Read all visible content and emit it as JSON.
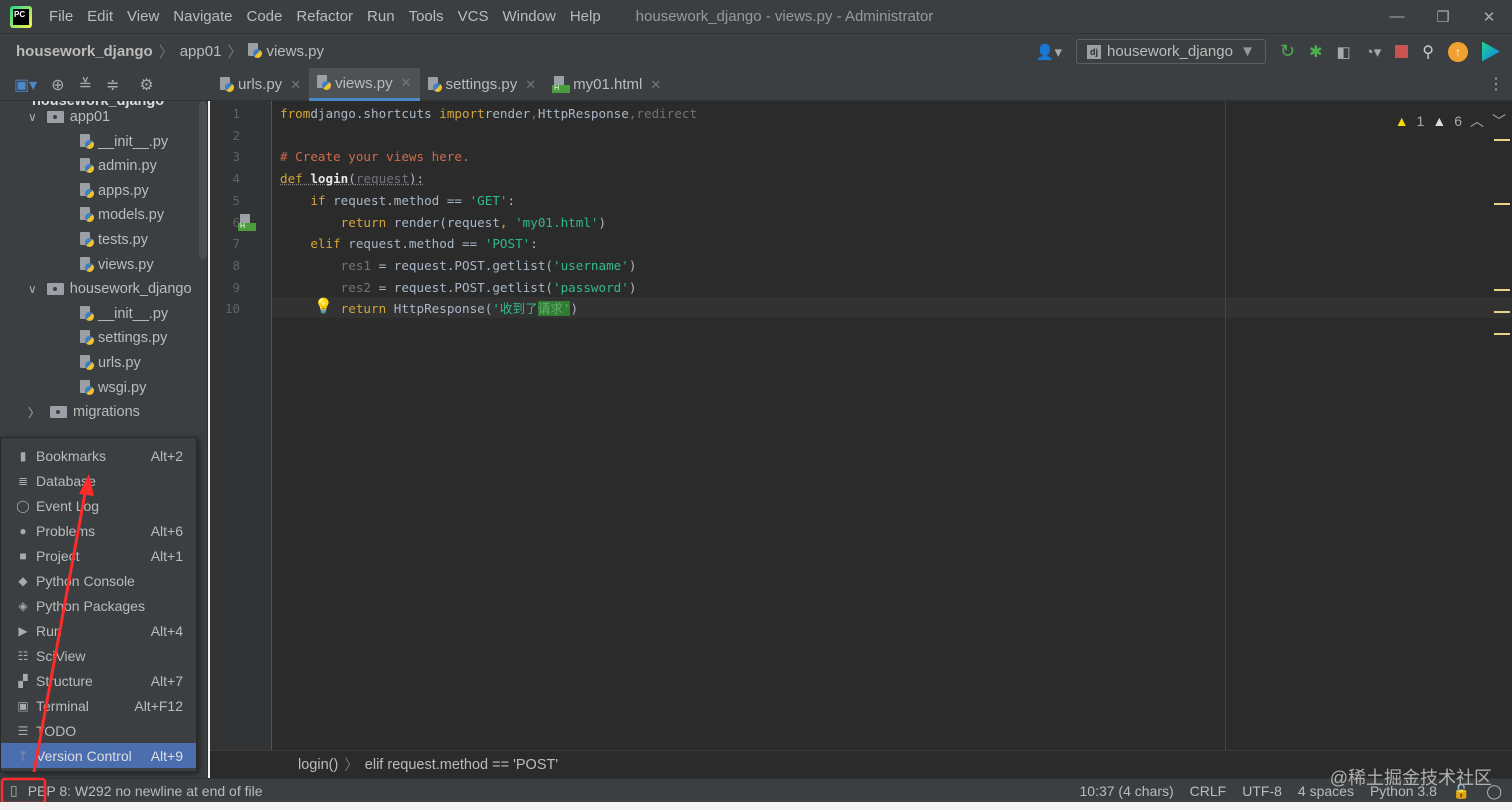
{
  "menubar": {
    "logo": "PC",
    "items": [
      "File",
      "Edit",
      "View",
      "Navigate",
      "Code",
      "Refactor",
      "Run",
      "Tools",
      "VCS",
      "Window",
      "Help"
    ],
    "title": "housework_django - views.py - Administrator"
  },
  "navbar": {
    "crumbs": [
      "housework_django",
      "app01",
      "views.py"
    ],
    "run_config": "housework_django"
  },
  "tabs": [
    {
      "label": "urls.py",
      "icon": "python-file"
    },
    {
      "label": "views.py",
      "icon": "python-file",
      "active": true
    },
    {
      "label": "settings.py",
      "icon": "python-file"
    },
    {
      "label": "my01.html",
      "icon": "html-file"
    }
  ],
  "project_tree": {
    "root": "housework_django",
    "items": [
      {
        "label": "app01",
        "type": "folder",
        "level": 1
      },
      {
        "label": "__init__.py",
        "type": "py",
        "level": 2
      },
      {
        "label": "admin.py",
        "type": "py",
        "level": 2
      },
      {
        "label": "apps.py",
        "type": "py",
        "level": 2
      },
      {
        "label": "models.py",
        "type": "py",
        "level": 2
      },
      {
        "label": "tests.py",
        "type": "py",
        "level": 2
      },
      {
        "label": "views.py",
        "type": "py",
        "level": 2
      },
      {
        "label": "housework_django",
        "type": "folder",
        "level": 1
      },
      {
        "label": "__init__.py",
        "type": "py",
        "level": 2
      },
      {
        "label": "settings.py",
        "type": "py",
        "level": 2
      },
      {
        "label": "urls.py",
        "type": "py",
        "level": 2
      },
      {
        "label": "wsgi.py",
        "type": "py",
        "level": 2
      },
      {
        "label": "migrations",
        "type": "folder",
        "level": 1,
        "collapsed": true
      }
    ]
  },
  "editor": {
    "lines": [
      [
        [
          "kw",
          "from"
        ],
        [
          "",
          "django.shortcuts "
        ],
        [
          "kw",
          "import"
        ],
        [
          "",
          "render"
        ],
        [
          "dim",
          ","
        ],
        [
          "",
          "HttpResponse"
        ],
        [
          "dim",
          ",redirect"
        ]
      ],
      [],
      [
        [
          "cmt",
          "# Create your views here."
        ]
      ],
      [
        [
          "kw und",
          "def "
        ],
        [
          "fnb und",
          "login"
        ],
        [
          "und",
          "("
        ],
        [
          "dim und",
          "request"
        ],
        [
          "und",
          "):"
        ]
      ],
      [
        [
          "",
          "    "
        ],
        [
          "kw",
          "if"
        ],
        [
          "",
          " request.method == "
        ],
        [
          "str",
          "'GET'"
        ],
        [
          "",
          ":"
        ]
      ],
      [
        [
          "",
          "        "
        ],
        [
          "kw",
          "return"
        ],
        [
          "",
          " render(request"
        ],
        [
          "kw",
          ", "
        ],
        [
          "str",
          "'my01.html'"
        ],
        [
          "",
          ")"
        ]
      ],
      [
        [
          "",
          "    "
        ],
        [
          "kw",
          "elif"
        ],
        [
          "",
          " request.method == "
        ],
        [
          "str",
          "'POST'"
        ],
        [
          "",
          ":"
        ]
      ],
      [
        [
          "",
          "        "
        ],
        [
          "dim",
          "res1"
        ],
        [
          "",
          " = request.POST.getlist("
        ],
        [
          "str",
          "'username'"
        ],
        [
          "",
          ")"
        ]
      ],
      [
        [
          "",
          "        "
        ],
        [
          "dim",
          "res2"
        ],
        [
          "",
          " = request.POST.getlist("
        ],
        [
          "str",
          "'password'"
        ],
        [
          "",
          ")"
        ]
      ],
      [
        [
          "",
          "        "
        ],
        [
          "kw",
          "return"
        ],
        [
          "",
          " HttpResponse("
        ],
        [
          "str",
          "'收到了"
        ],
        [
          "sel",
          "请求'"
        ],
        [
          "",
          ")"
        ]
      ]
    ],
    "warnings": {
      "errors": "1",
      "warnings": "6"
    },
    "breadcrumb": [
      "login()",
      "elif request.method == 'POST'"
    ]
  },
  "popup_menu": [
    {
      "label": "Bookmarks",
      "shortcut": "Alt+2",
      "icon": "bookmark-icon",
      "glyph": "▮"
    },
    {
      "label": "Database",
      "shortcut": "",
      "icon": "database-icon",
      "glyph": "≣"
    },
    {
      "label": "Event Log",
      "shortcut": "",
      "icon": "event-log-icon",
      "glyph": "◯"
    },
    {
      "label": "Problems",
      "shortcut": "Alt+6",
      "icon": "problems-icon",
      "glyph": "●"
    },
    {
      "label": "Project",
      "shortcut": "Alt+1",
      "icon": "folder-icon",
      "glyph": "■"
    },
    {
      "label": "Python Console",
      "shortcut": "",
      "icon": "python-console-icon",
      "glyph": "◆"
    },
    {
      "label": "Python Packages",
      "shortcut": "",
      "icon": "layers-icon",
      "glyph": "◈"
    },
    {
      "label": "Run",
      "shortcut": "Alt+4",
      "icon": "run-icon",
      "glyph": "▶"
    },
    {
      "label": "SciView",
      "shortcut": "",
      "icon": "sciview-icon",
      "glyph": "☷"
    },
    {
      "label": "Structure",
      "shortcut": "Alt+7",
      "icon": "structure-icon",
      "glyph": "▞"
    },
    {
      "label": "Terminal",
      "shortcut": "Alt+F12",
      "icon": "terminal-icon",
      "glyph": "▣"
    },
    {
      "label": "TODO",
      "shortcut": "",
      "icon": "todo-icon",
      "glyph": "☰"
    },
    {
      "label": "Version Control",
      "shortcut": "Alt+9",
      "icon": "branch-icon",
      "glyph": "ᛘ",
      "selected": true
    }
  ],
  "statusbar": {
    "message": "PEP 8: W292 no newline at end of file",
    "position": "10:37 (4 chars)",
    "line_sep": "CRLF",
    "encoding": "UTF-8",
    "indent": "4 spaces",
    "interpreter": "Python 3.8"
  },
  "watermark": "@稀土掘金技术社区",
  "colors": {
    "annotation": "#ff2a2a",
    "selection": "#4b6eaf",
    "tab_underline": "#4a88c7"
  }
}
